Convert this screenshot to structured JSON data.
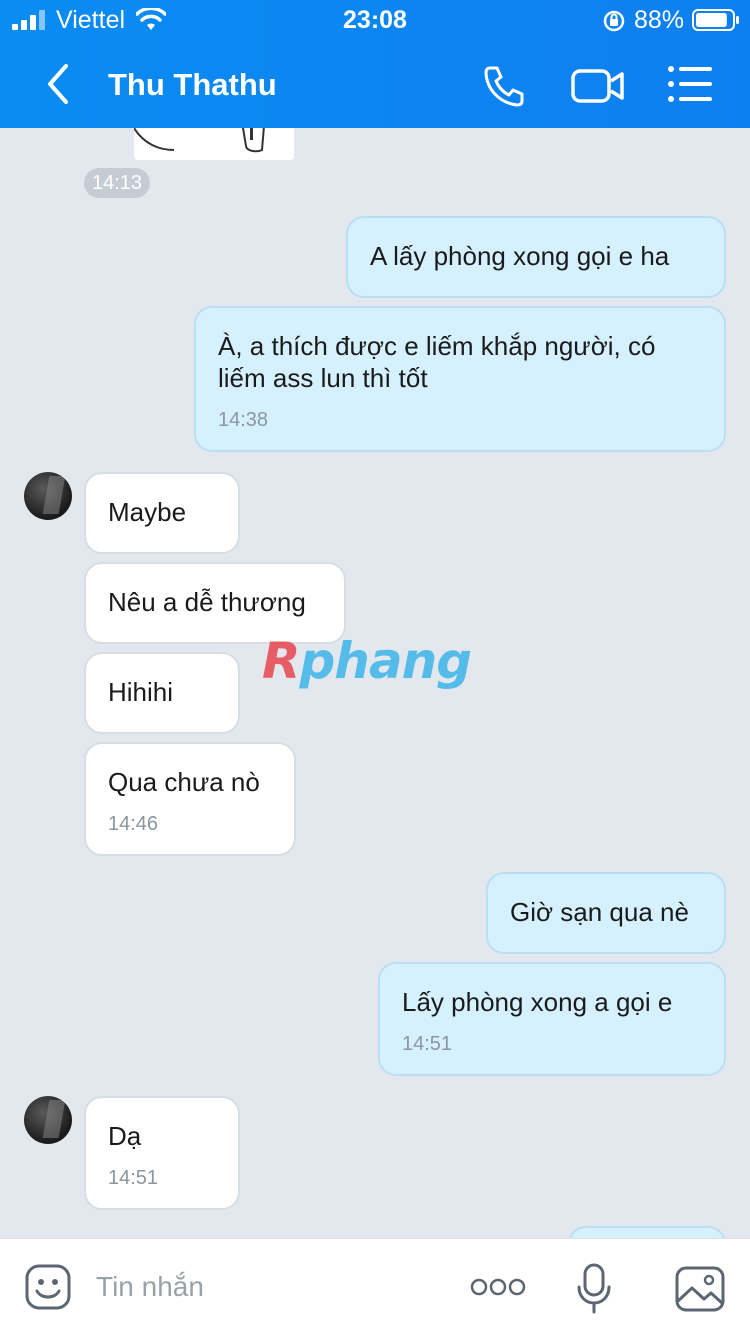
{
  "status": {
    "carrier": "Viettel",
    "time": "23:08",
    "battery": "88%",
    "battery_level": 0.88,
    "icons": [
      "signal-icon",
      "wifi-icon",
      "orientation-lock-icon",
      "battery-icon"
    ]
  },
  "header": {
    "title": "Thu Thathu",
    "icons": [
      "back-icon",
      "phone-call-icon",
      "video-call-icon",
      "menu-icon"
    ],
    "background": "#0a8cf2"
  },
  "messages": {
    "sticker_time": "14:13",
    "m1": {
      "text": "A lấy phòng xong gọi e ha"
    },
    "m2": {
      "text": "À, a thích được e liếm khắp người, có liếm ass lun thì tốt",
      "time": "14:38"
    },
    "m3": {
      "text": "Maybe"
    },
    "m4": {
      "text": "Nêu a dễ thương"
    },
    "m5": {
      "text": "Hihihi"
    },
    "m6": {
      "text": "Qua chưa nò",
      "time": "14:46"
    },
    "m7": {
      "text": "Giờ sạn qua nè"
    },
    "m8": {
      "text": "Lấy phòng xong a gọi e",
      "time": "14:51"
    },
    "m9": {
      "text": "Dạ",
      "time": "14:51"
    }
  },
  "watermark": {
    "first": "R",
    "rest": "phang"
  },
  "input": {
    "placeholder": "Tin nhắn",
    "icons": [
      "emoji-icon",
      "more-icon",
      "microphone-icon",
      "image-icon"
    ]
  },
  "colors": {
    "outgoing_bubble": "#d5f1ff",
    "incoming_bubble": "#ffffff",
    "chat_background": "#e3e8ef"
  }
}
